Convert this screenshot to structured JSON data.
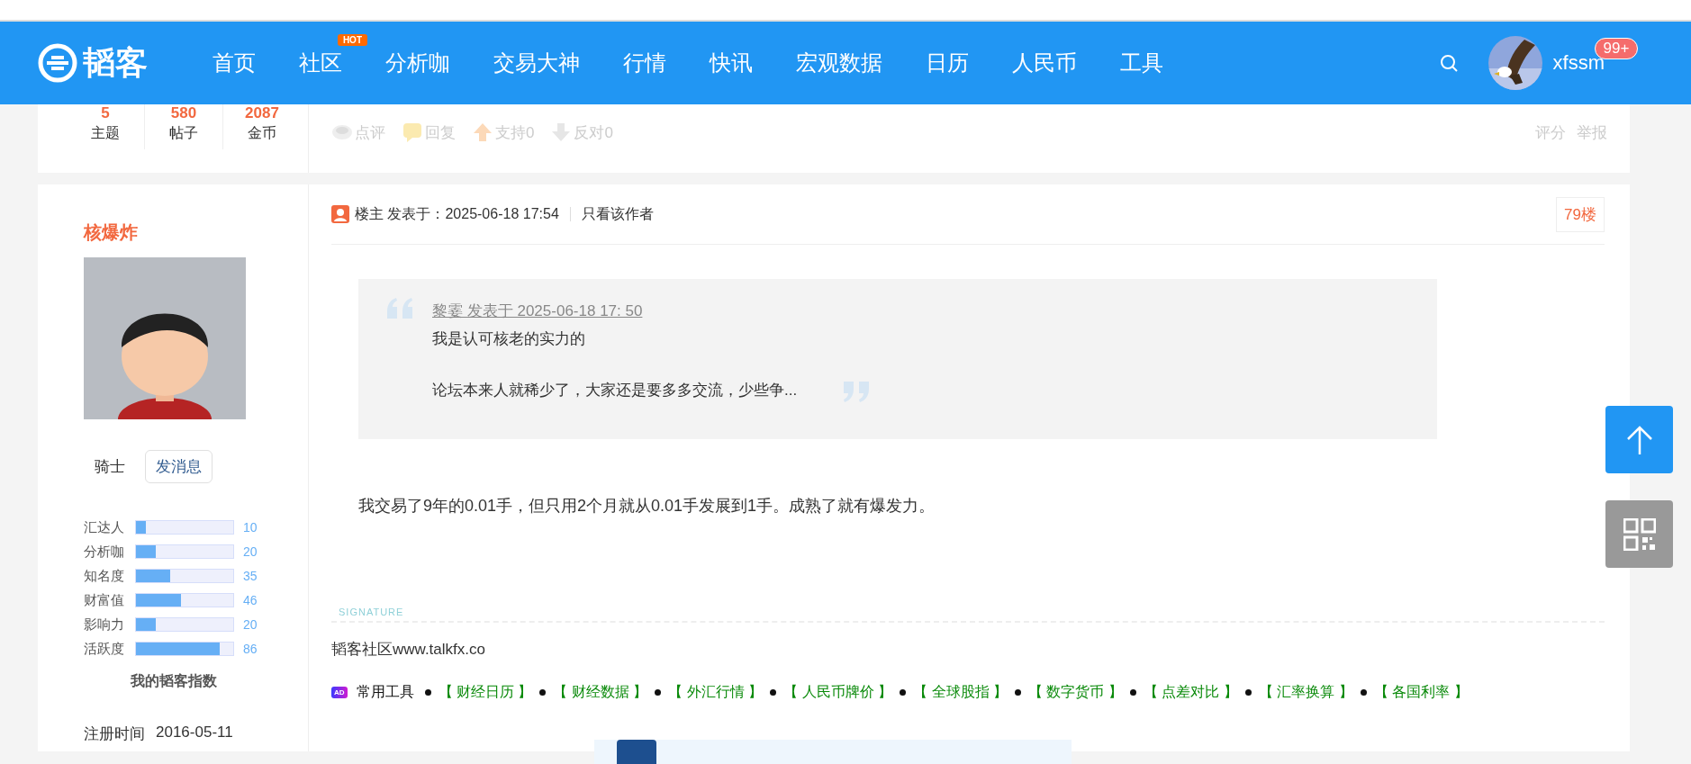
{
  "header": {
    "logo_text": "韬客",
    "nav": [
      {
        "label": "首页"
      },
      {
        "label": "社区",
        "badge": "HOT"
      },
      {
        "label": "分析咖"
      },
      {
        "label": "交易大神"
      },
      {
        "label": "行情"
      },
      {
        "label": "快讯"
      },
      {
        "label": "宏观数据"
      },
      {
        "label": "日历"
      },
      {
        "label": "人民币"
      },
      {
        "label": "工具"
      }
    ],
    "username": "xfssm",
    "notification_count": "99+"
  },
  "prev_post": {
    "stats": [
      {
        "value": "5",
        "label": "主题"
      },
      {
        "value": "580",
        "label": "帖子"
      },
      {
        "value": "2087",
        "label": "金币"
      }
    ],
    "actions": [
      {
        "kind": "comment",
        "label": "点评"
      },
      {
        "kind": "reply",
        "label": "回复"
      },
      {
        "kind": "up",
        "label": "支持0"
      },
      {
        "kind": "down",
        "label": "反对0"
      }
    ],
    "links": [
      "评分",
      "举报"
    ]
  },
  "author": {
    "name": "核爆炸",
    "rank": "骑士",
    "message_button": "发消息",
    "indices": [
      {
        "label": "汇达人",
        "value": "10",
        "level": 0.1
      },
      {
        "label": "分析咖",
        "value": "20",
        "level": 0.2
      },
      {
        "label": "知名度",
        "value": "35",
        "level": 0.35
      },
      {
        "label": "财富值",
        "value": "46",
        "level": 0.46
      },
      {
        "label": "影响力",
        "value": "20",
        "level": 0.2
      },
      {
        "label": "活跃度",
        "value": "86",
        "level": 0.86
      }
    ],
    "indices_caption": "我的韬客指数",
    "reg_label": "注册时间",
    "reg_date": "2016-05-11"
  },
  "post": {
    "role": "楼主",
    "posted": "发表于：2025-06-18 17:54",
    "author_only": "只看该作者",
    "floor": "79楼",
    "quote": {
      "source": "黎霎 发表于 2025-06-18 17: 50",
      "lines": [
        "我是认可核老的实力的",
        "论坛本来人就稀少了，大家还是要多多交流，少些争..."
      ]
    },
    "body": "我交易了9年的0.01手，但只用2个月就从0.01手发展到1手。成熟了就有爆发力。",
    "signature_label": "SIGNATURE",
    "signature": "韬客社区www.talkfx.co",
    "tools_badge": "AD",
    "tools_title": "常用工具",
    "tools": [
      "【 财经日历 】",
      "【 财经数据 】",
      "【 外汇行情 】",
      "【 人民币牌价 】",
      "【 全球股指 】",
      "【 数字货币 】",
      "【 点差对比 】",
      "【 汇率换算 】",
      "【 各国利率 】"
    ]
  }
}
